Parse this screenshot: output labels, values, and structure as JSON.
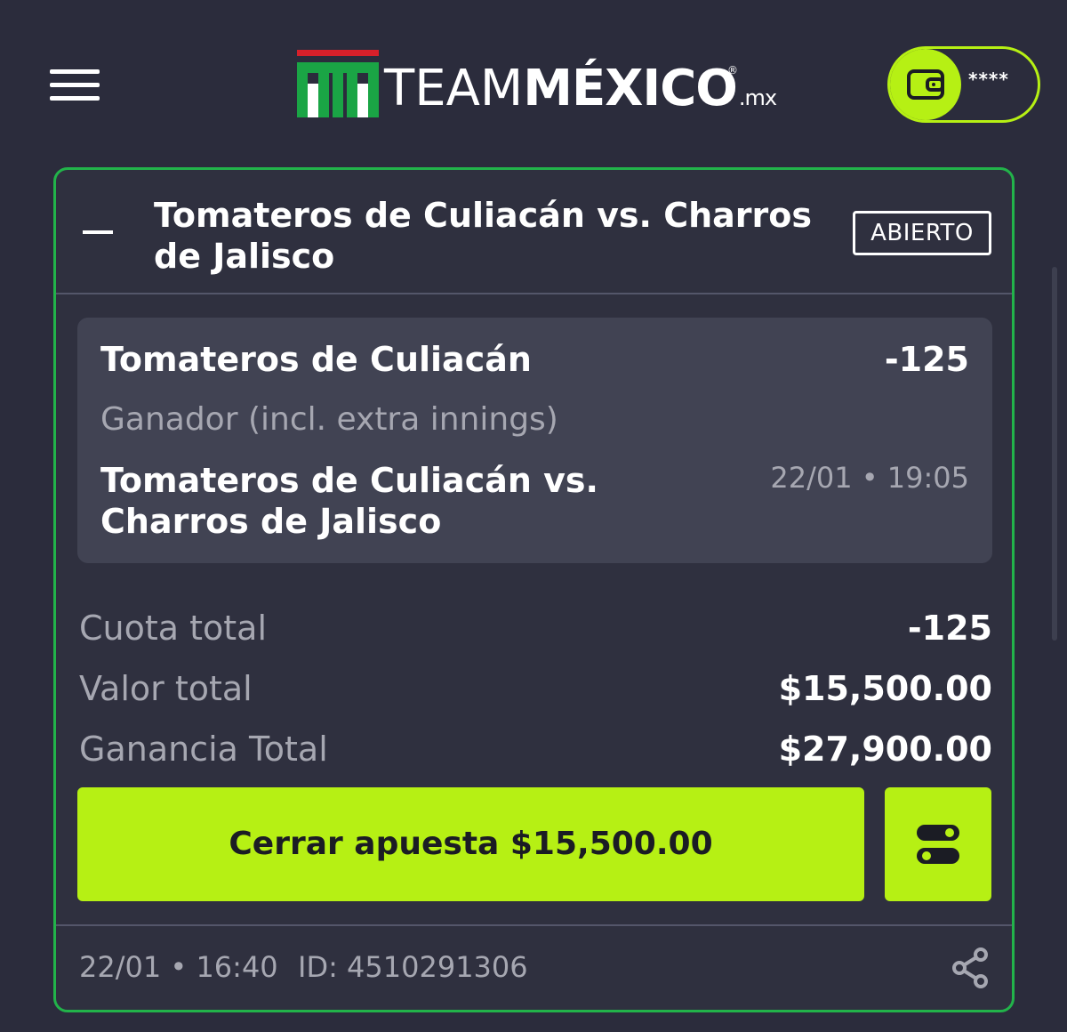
{
  "header": {
    "menu_icon": "hamburger-menu-icon",
    "logo": {
      "brand_light": "TEAM",
      "brand_bold": "MÉXICO",
      "suffix": ".mx",
      "registered": "®",
      "colors": {
        "green": "#1aa545",
        "red": "#d6202a",
        "white": "#ffffff"
      }
    },
    "wallet": {
      "icon": "wallet-icon",
      "balance": "****"
    }
  },
  "bet": {
    "event_title": "Tomateros de Culiacán vs. Charros de Jalisco",
    "status": "ABIERTO",
    "selection": {
      "team": "Tomateros de Culiacán",
      "odds": "-125",
      "market": "Ganador (incl. extra innings)",
      "event": "Tomateros de Culiacán vs. Charros de Jalisco",
      "datetime": "22/01 • 19:05"
    },
    "summary": {
      "cuota_label": "Cuota total",
      "cuota_value": "-125",
      "valor_label": "Valor total",
      "valor_value": "$15,500.00",
      "ganancia_label": "Ganancia Total",
      "ganancia_value": "$27,900.00"
    },
    "cashout_label": "Cerrar apuesta $15,500.00",
    "toggle_icon": "toggle-settings-icon",
    "footer": {
      "placed": "22/01 • 16:40",
      "id": "ID: 4510291306",
      "share_icon": "share-icon"
    }
  },
  "colors": {
    "background": "#2b2c3c",
    "card_border": "#22b34a",
    "accent": "#b6f014",
    "panel": "#414353",
    "muted_text": "#a6a7b1"
  }
}
